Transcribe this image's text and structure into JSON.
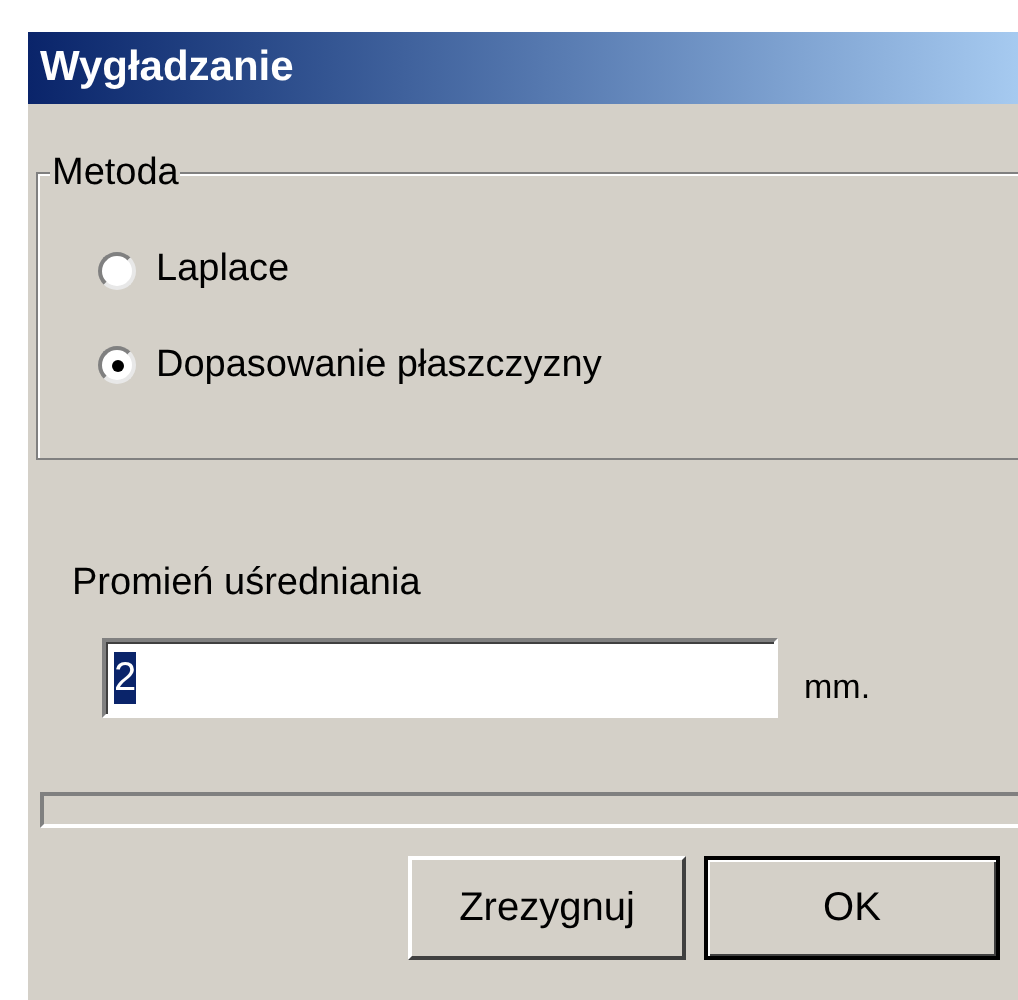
{
  "window": {
    "title": "Wygładzanie"
  },
  "method": {
    "legend": "Metoda",
    "options": [
      {
        "label": "Laplace",
        "selected": false
      },
      {
        "label": "Dopasowanie płaszczyzny",
        "selected": true
      }
    ]
  },
  "radius": {
    "label": "Promień uśredniania",
    "value": "2",
    "value_highlighted": true,
    "unit": "mm."
  },
  "buttons": [
    {
      "label": "Zrezygnuj",
      "default": false
    },
    {
      "label": "OK",
      "default": true
    }
  ]
}
